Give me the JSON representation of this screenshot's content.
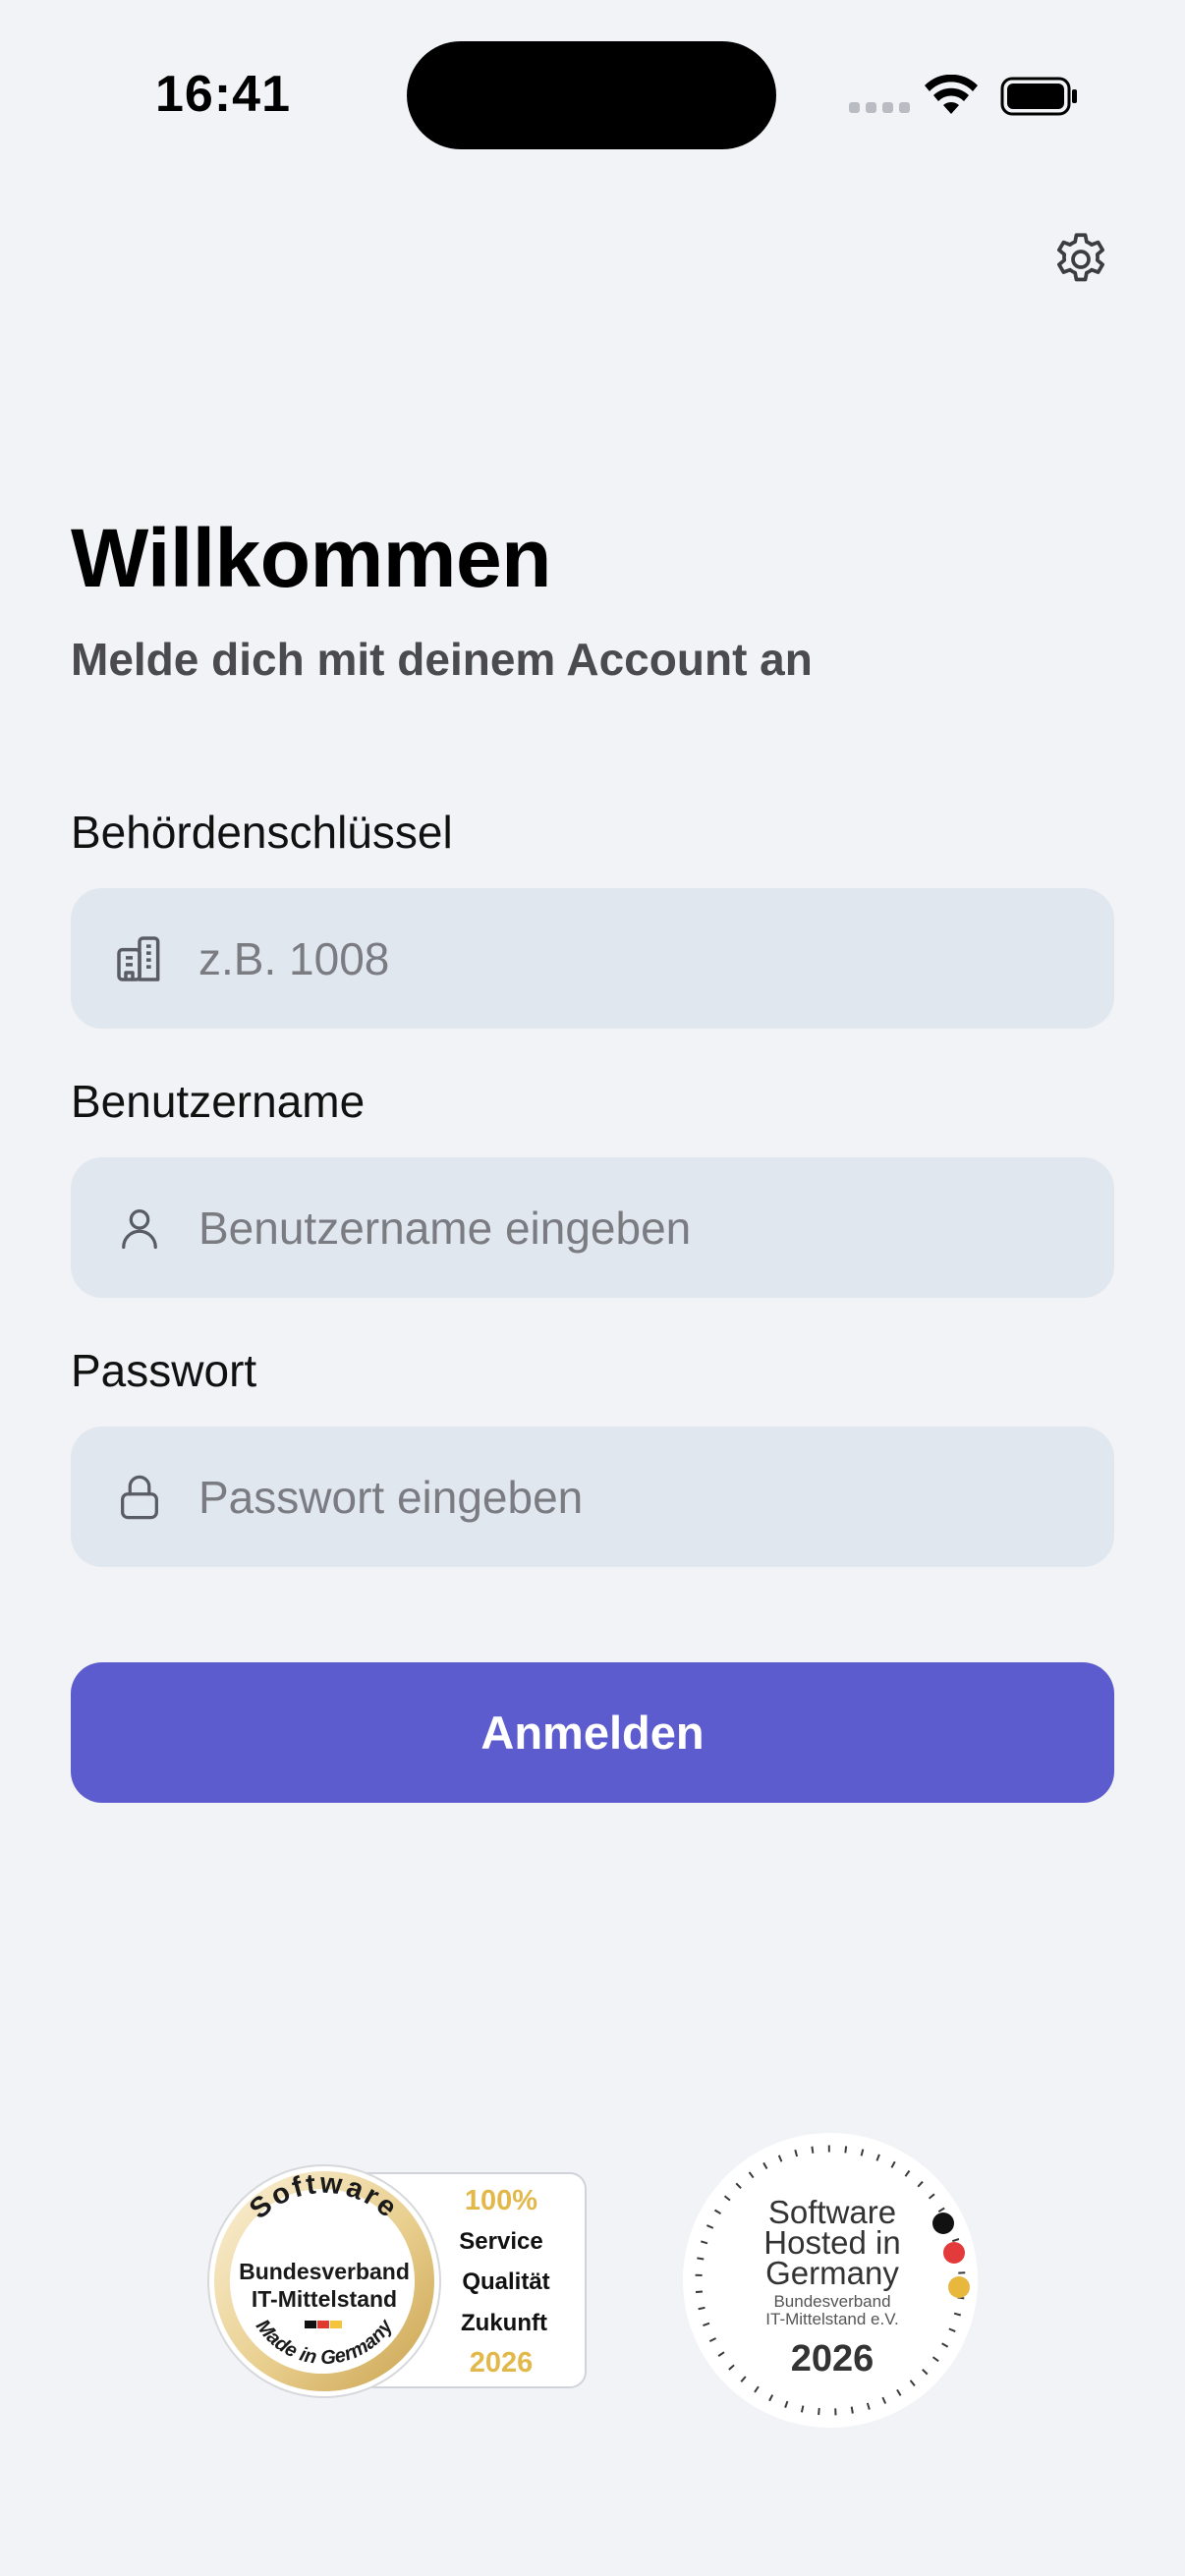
{
  "status": {
    "time": "16:41"
  },
  "welcome": {
    "title": "Willkommen",
    "subtitle": "Melde dich mit deinem Account an"
  },
  "fields": {
    "authority_key": {
      "label": "Behördenschlüssel",
      "placeholder": "z.B. 1008",
      "value": "",
      "icon": "building-icon"
    },
    "username": {
      "label": "Benutzername",
      "placeholder": "Benutzername eingeben",
      "value": "",
      "icon": "user-icon"
    },
    "password": {
      "label": "Passwort",
      "placeholder": "Passwort eingeben",
      "value": "",
      "icon": "lock-icon"
    }
  },
  "login_button": {
    "label": "Anmelden",
    "color": "#5d5ccf"
  },
  "badges": {
    "made_in_germany": {
      "arc_top": "Software",
      "line1": "Bundesverband",
      "line2": "IT-Mittelstand",
      "arc_bottom": "Made in Germany",
      "side_lines": [
        "100%",
        "Service",
        "Qualität",
        "Zukunft",
        "2026"
      ]
    },
    "hosted_in_germany": {
      "line1": "Software",
      "line2": "Hosted in",
      "line3": "Germany",
      "line4": "Bundesverband",
      "line5": "IT-Mittelstand e.V.",
      "year": "2026"
    }
  }
}
